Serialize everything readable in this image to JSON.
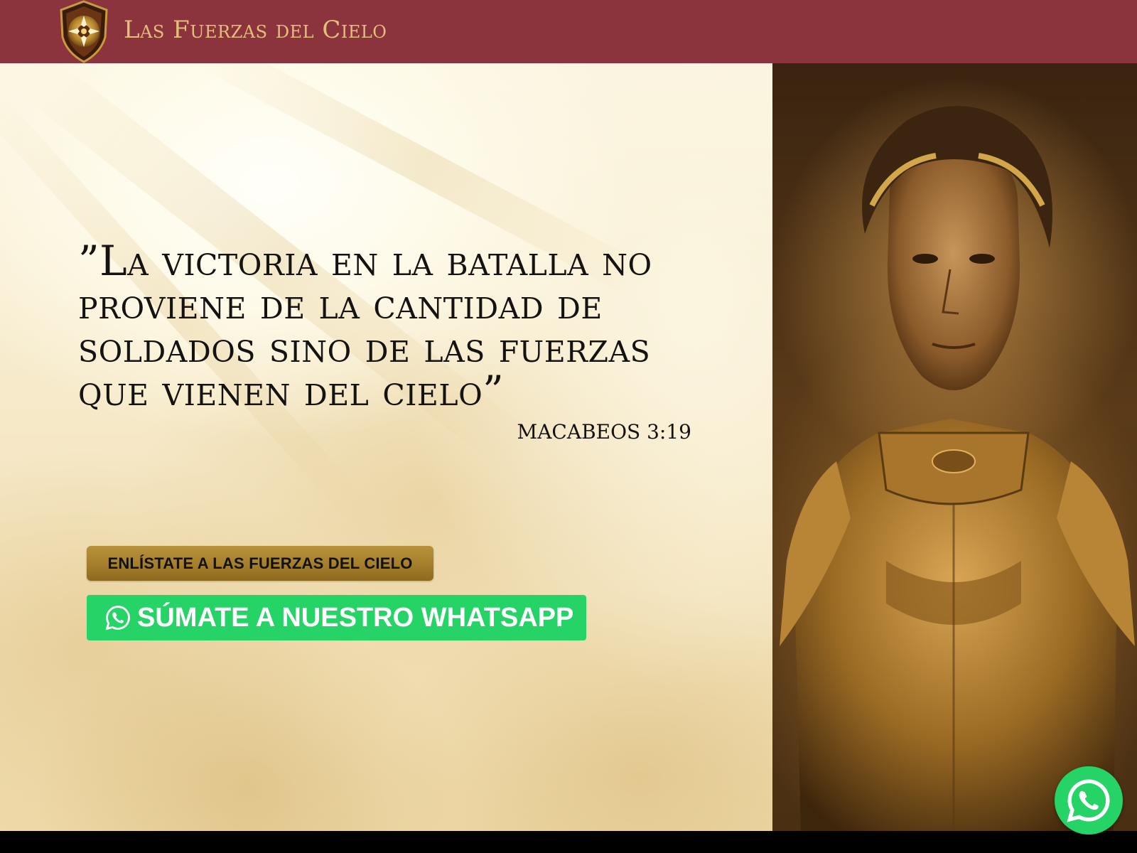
{
  "header": {
    "brand": "Las Fuerzas del Cielo",
    "logo_icon": "shield-cross-emblem-icon",
    "colors": {
      "background": "#8c343d",
      "brand_text": "#e2c07a"
    }
  },
  "hero": {
    "quote": "”La victoria en la batalla no proviene de la cantidad de soldados sino de las fuerzas que vienen del cielo”",
    "quote_reference": "MACABEOS 3:19",
    "enlist_button": "ENLÍSTATE A LAS FUERZAS DEL CIELO",
    "whatsapp_button": "SÚMATE A NUESTRO WHATSAPP",
    "whatsapp_icon": "whatsapp-icon",
    "colors": {
      "enlist_gold": "#a6802c",
      "whatsapp_green": "#25d366"
    }
  },
  "floating": {
    "icon": "whatsapp-icon"
  }
}
